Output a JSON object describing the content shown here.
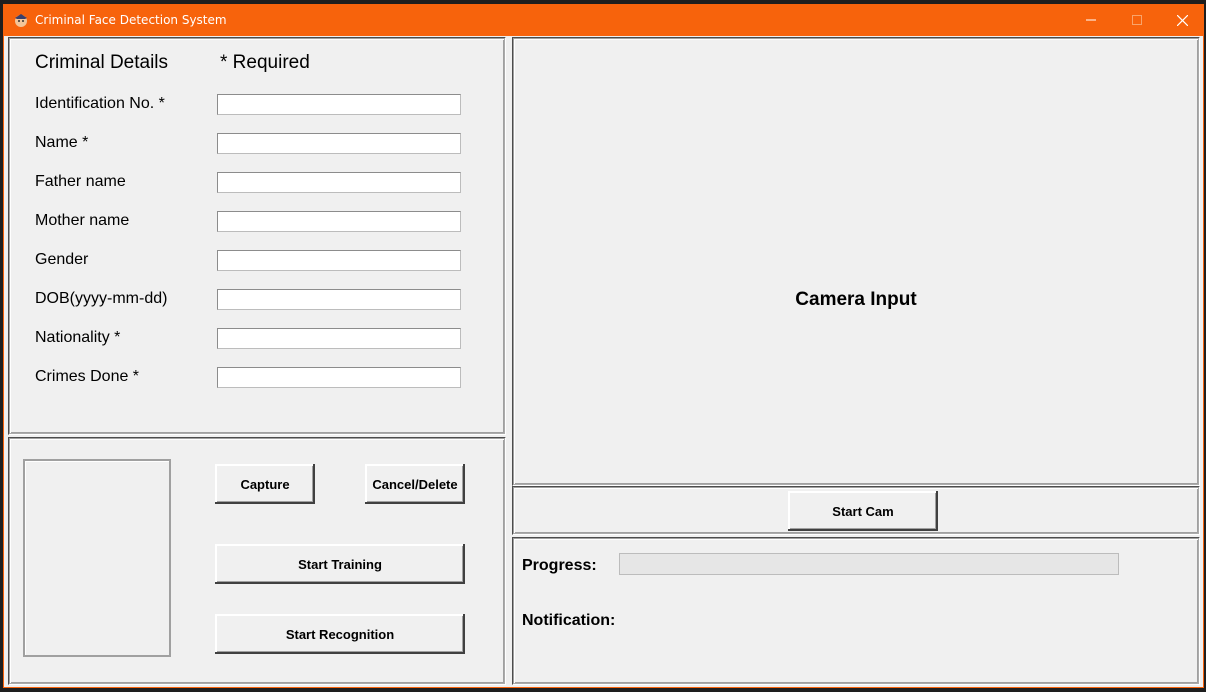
{
  "window": {
    "title": "Criminal Face Detection System",
    "accent_color": "#f7630c"
  },
  "details": {
    "heading": "Criminal Details",
    "required_note": "* Required",
    "fields": [
      {
        "label": "Identification No. *",
        "value": ""
      },
      {
        "label": "Name *",
        "value": ""
      },
      {
        "label": "Father name",
        "value": ""
      },
      {
        "label": "Mother name",
        "value": ""
      },
      {
        "label": "Gender",
        "value": ""
      },
      {
        "label": "DOB(yyyy-mm-dd)",
        "value": ""
      },
      {
        "label": "Nationality *",
        "value": ""
      },
      {
        "label": "Crimes Done *",
        "value": ""
      }
    ]
  },
  "capture": {
    "capture_label": "Capture",
    "cancel_label": "Cancel/Delete",
    "train_label": "Start Training",
    "recognize_label": "Start Recognition"
  },
  "camera": {
    "label": "Camera Input",
    "start_label": "Start Cam"
  },
  "status": {
    "progress_label": "Progress:",
    "progress_value": 0,
    "notification_label": "Notification:"
  },
  "icons": [
    "app-icon",
    "minimize-icon",
    "maximize-icon",
    "close-icon"
  ]
}
